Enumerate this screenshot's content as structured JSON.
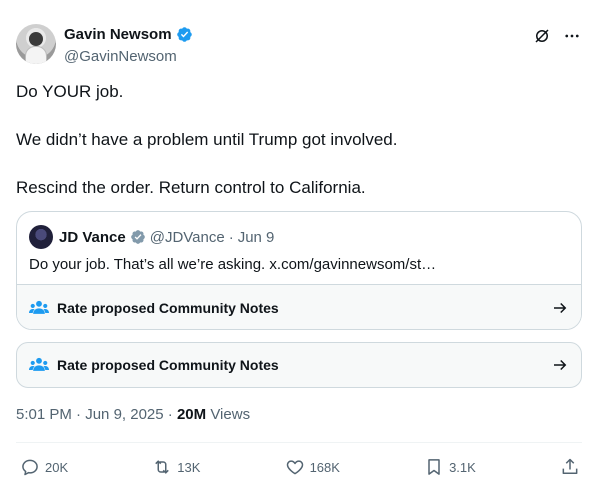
{
  "author": {
    "display_name": "Gavin Newsom",
    "handle": "@GavinNewsom"
  },
  "tweet": {
    "lines": [
      "Do YOUR job.",
      "We didn’t have a problem until Trump got involved.",
      "Rescind the order. Return control to California."
    ]
  },
  "quote": {
    "display_name": "JD Vance",
    "handle": "@JDVance",
    "separator": "·",
    "date": "Jun 9",
    "text": "Do your job. That’s all we’re asking. x.com/gavinnewsom/st…",
    "notes_label": "Rate proposed Community Notes"
  },
  "community_notes": {
    "label": "Rate proposed Community Notes"
  },
  "meta": {
    "time": "5:01 PM",
    "separator": "·",
    "date": "Jun 9, 2025",
    "views_count": "20M",
    "views_label": "Views"
  },
  "actions": {
    "replies": "20K",
    "reposts": "13K",
    "likes": "168K",
    "bookmarks": "3.1K"
  },
  "colors": {
    "accent": "#1d9bf0",
    "text": "#0f1419",
    "muted": "#536471",
    "border": "#cfd9de"
  }
}
